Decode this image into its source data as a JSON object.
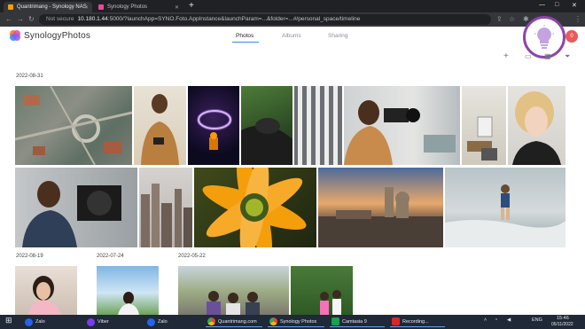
{
  "browser": {
    "tabs": [
      {
        "label": "Quantrimang - Synology NAS",
        "active": true
      },
      {
        "label": "Synology Photos",
        "active": false
      }
    ],
    "new_tab": "+",
    "address": {
      "security": "Not secure",
      "host": "10.180.1.44",
      "path": ":5000/?launchApp=SYNO.Foto.AppInstance&launchParam=...&folder=...#/personal_space/timeline"
    },
    "nav": {
      "back": "←",
      "forward": "→",
      "reload": "↻"
    }
  },
  "app": {
    "name": "SynologyPhotos",
    "tabs": [
      "Photos",
      "Albums",
      "Sharing"
    ],
    "notification_count": "0"
  },
  "timeline": {
    "groups": [
      {
        "date": "2022-08-31"
      },
      {
        "date": "2022-08-19"
      },
      {
        "date": "2022-07-24"
      },
      {
        "date": "2022-05-22"
      }
    ]
  },
  "taskbar": {
    "items": [
      "Zalo",
      "Viber",
      "Zalo",
      "Quantrimang.com",
      "Synology Photos",
      "Camtasia 9",
      "Recording..."
    ],
    "lang": "ENG",
    "time": "15:46",
    "date": "05/11/2022"
  },
  "colors": {
    "accent": "#3b82f6",
    "assistant_ring": "#8e44ad",
    "badge": "#e85a5a"
  }
}
